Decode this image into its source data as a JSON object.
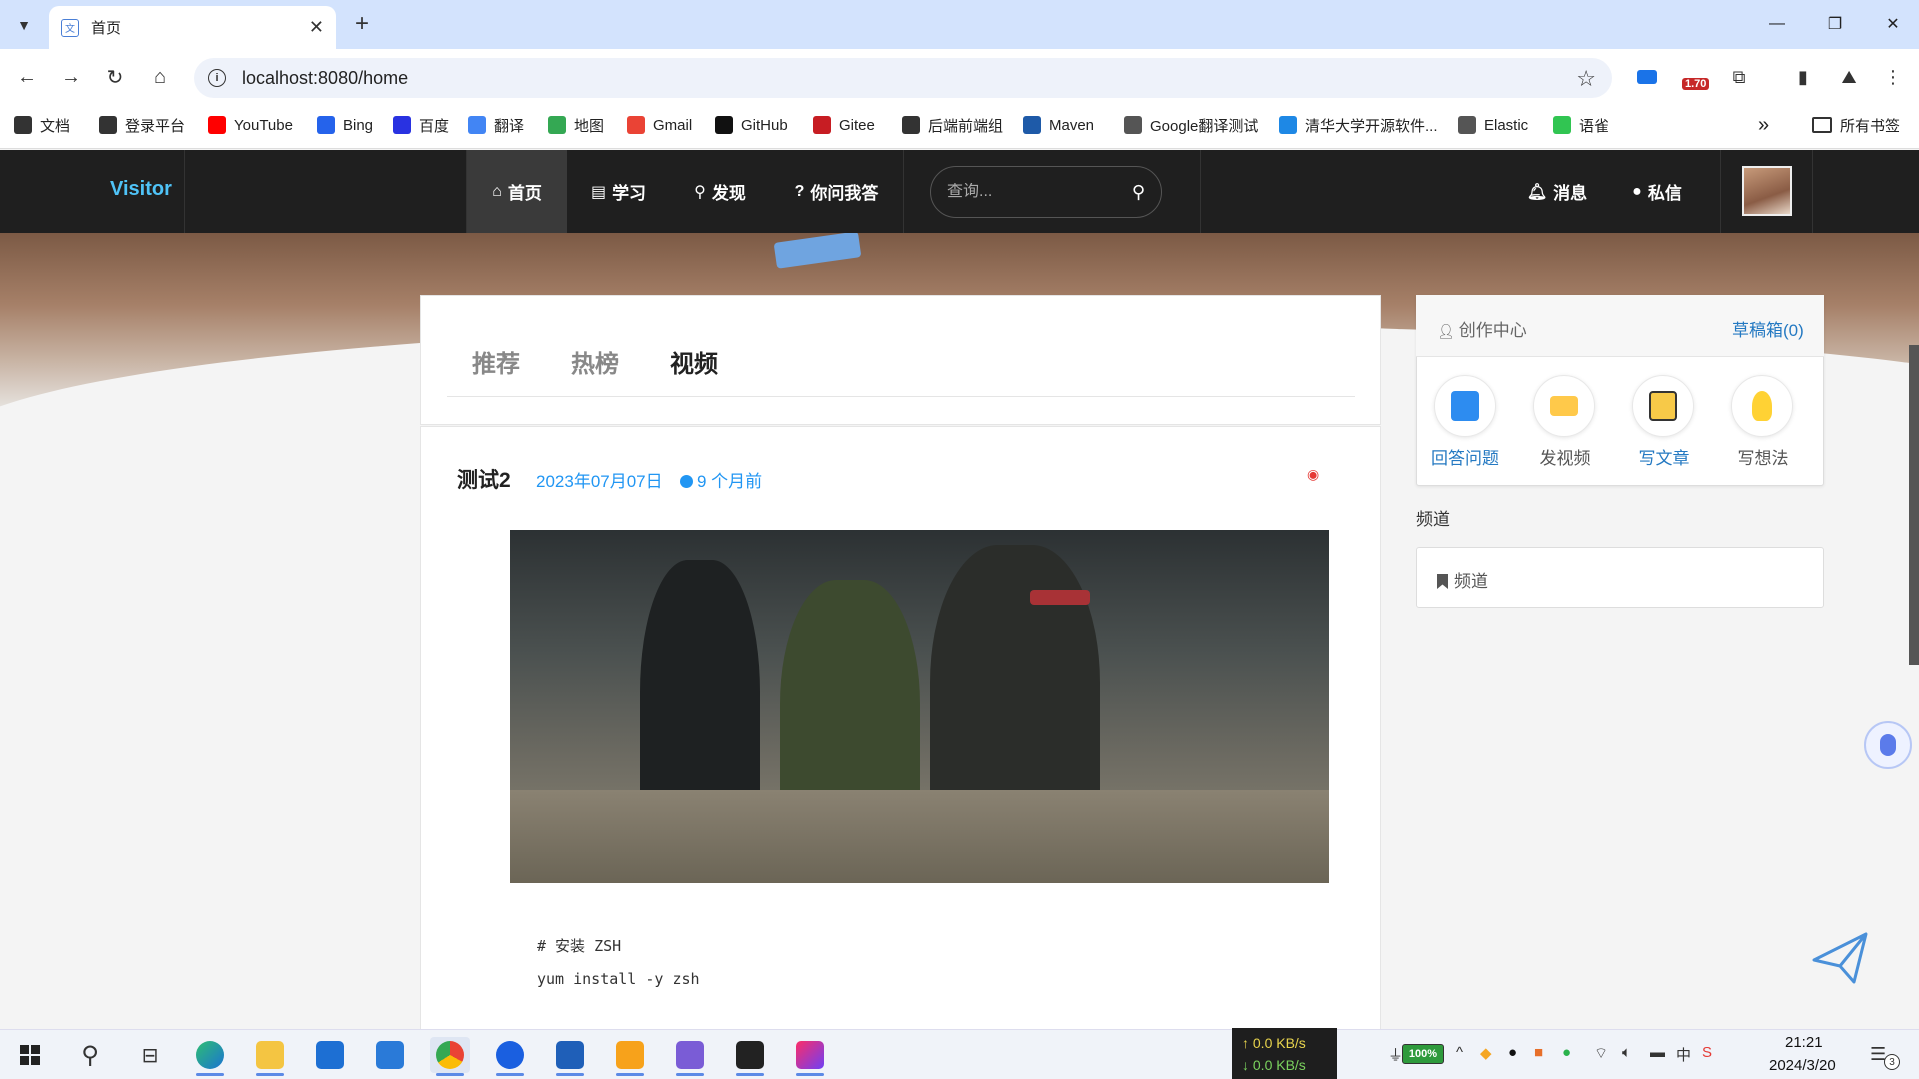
{
  "browser": {
    "tab_title": "首页",
    "url": "localhost:8080/home",
    "extension_badge": "1.70",
    "bookmarks": [
      {
        "label": "文档",
        "color": "#333333"
      },
      {
        "label": "登录平台",
        "color": "#333333"
      },
      {
        "label": "YouTube",
        "color": "#ff0000"
      },
      {
        "label": "Bing",
        "color": "#2563eb"
      },
      {
        "label": "百度",
        "color": "#2932e1"
      },
      {
        "label": "翻译",
        "color": "#4285f4"
      },
      {
        "label": "地图",
        "color": "#34a853"
      },
      {
        "label": "Gmail",
        "color": "#ea4335"
      },
      {
        "label": "GitHub",
        "color": "#111111"
      },
      {
        "label": "Gitee",
        "color": "#c71d23"
      },
      {
        "label": "后端前端组",
        "color": "#333333"
      },
      {
        "label": "Maven",
        "color": "#1e5aa8"
      },
      {
        "label": "Google翻译测试",
        "color": "#555555"
      },
      {
        "label": "清华大学开源软件...",
        "color": "#1e88e5"
      },
      {
        "label": "Elastic",
        "color": "#555555"
      },
      {
        "label": "语雀",
        "color": "#31c552"
      }
    ],
    "all_bookmarks": "所有书签"
  },
  "site": {
    "brand": "Visitor",
    "nav": {
      "home": "首页",
      "study": "学习",
      "discover": "发现",
      "qa": "你问我答",
      "messages": "消息",
      "private_messages": "私信"
    },
    "search_placeholder": "查询..."
  },
  "feed": {
    "tabs": [
      "推荐",
      "热榜",
      "视频"
    ],
    "active_tab": "视频"
  },
  "post": {
    "title": "测试2",
    "date": "2023年07月07日",
    "relative_time": "9 个月前",
    "code_lines": [
      "# 安装 ZSH",
      "yum install -y zsh"
    ]
  },
  "sidebar": {
    "creator_title": "创作中心",
    "drafts": "草稿箱(0)",
    "actions": [
      {
        "label": "回答问题",
        "color": "#2479c2",
        "icon": "document-icon"
      },
      {
        "label": "发视频",
        "color": "#555555",
        "icon": "video-icon"
      },
      {
        "label": "写文章",
        "color": "#2479c2",
        "icon": "article-icon"
      },
      {
        "label": "写想法",
        "color": "#555555",
        "icon": "lightbulb-icon"
      }
    ],
    "channel_heading": "频道",
    "channel_item": "频道"
  },
  "taskbar": {
    "net_up": "↑ 0.0 KB/s",
    "net_down": "↓ 0.0 KB/s",
    "battery": "100%",
    "time": "21:21",
    "date": "2024/3/20",
    "notification_count": "3"
  }
}
